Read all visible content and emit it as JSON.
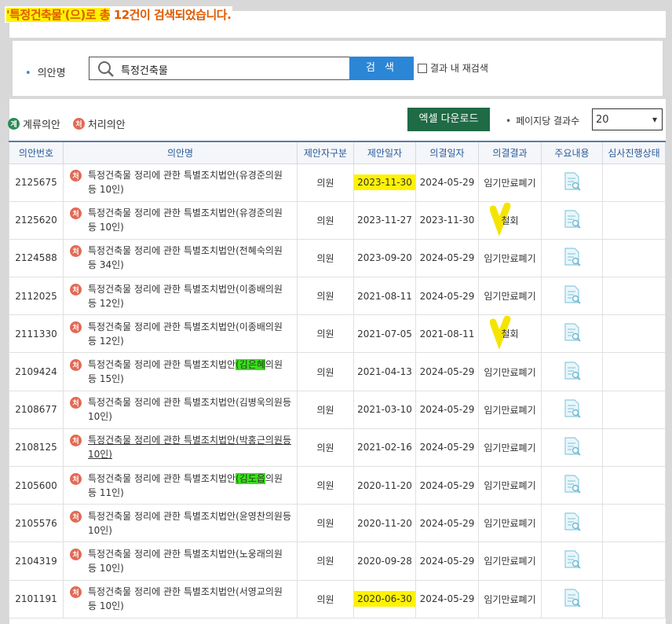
{
  "result_message": {
    "prefix_highlight": "'특정건축물'(으)로 총",
    "count": "12건",
    "suffix": "이 검색되었습니다."
  },
  "search": {
    "label": "의안명",
    "value": "특정건축물",
    "button": "검 색",
    "re_search_label": "결과 내 재검색"
  },
  "legend": {
    "pending_badge": "계",
    "pending_label": "계류의안",
    "processed_badge": "처",
    "processed_label": "처리의안"
  },
  "toolbar": {
    "excel_label": "엑셀 다운로드",
    "per_page_label": "페이지당 결과수",
    "per_page_value": "20"
  },
  "table": {
    "headers": [
      "의안번호",
      "의안명",
      "제안자구분",
      "제안일자",
      "의결일자",
      "의결결과",
      "주요내용",
      "심사진행상태"
    ],
    "rows": [
      {
        "no": "2125675",
        "title_a": "특정건축물 정리에 관한 특별조치법안(유경준의원",
        "title_b": "등 10인)",
        "proposer": "의원",
        "proposed": "2023-11-30",
        "decided": "2024-05-29",
        "result": "임기만료폐기"
      },
      {
        "no": "2125620",
        "title_a": "특정건축물 정리에 관한 특별조치법안(유경준의원",
        "title_b": "등 10인)",
        "proposer": "의원",
        "proposed": "2023-11-27",
        "decided": "2023-11-30",
        "result": "철회"
      },
      {
        "no": "2124588",
        "title_a": "특정건축물 정리에 관한 특별조치법안(전혜숙의원",
        "title_b": "등 34인)",
        "proposer": "의원",
        "proposed": "2023-09-20",
        "decided": "2024-05-29",
        "result": "임기만료폐기"
      },
      {
        "no": "2112025",
        "title_a": "특정건축물 정리에 관한 특별조치법안(이종배의원",
        "title_b": "등 12인)",
        "proposer": "의원",
        "proposed": "2021-08-11",
        "decided": "2024-05-29",
        "result": "임기만료폐기"
      },
      {
        "no": "2111330",
        "title_a": "특정건축물 정리에 관한 특별조치법안(이종배의원",
        "title_b": "등 12인)",
        "proposer": "의원",
        "proposed": "2021-07-05",
        "decided": "2021-08-11",
        "result": "철회"
      },
      {
        "no": "2109424",
        "title_a": "특정건축물 정리에 관한 특별조치법안(김은혜의원",
        "title_b": "등 15인)",
        "proposer": "의원",
        "proposed": "2021-04-13",
        "decided": "2024-05-29",
        "result": "임기만료폐기"
      },
      {
        "no": "2108677",
        "title_a": "특정건축물 정리에 관한 특별조치법안(김병욱의원등",
        "title_b": "10인)",
        "proposer": "의원",
        "proposed": "2021-03-10",
        "decided": "2024-05-29",
        "result": "임기만료폐기"
      },
      {
        "no": "2108125",
        "title_a": "특정건축물 정리에 관한 특별조치법안(박홍근의원등",
        "title_b": "10인)",
        "proposer": "의원",
        "proposed": "2021-02-16",
        "decided": "2024-05-29",
        "result": "임기만료폐기"
      },
      {
        "no": "2105600",
        "title_a": "특정건축물 정리에 관한 특별조치법안(김도읍의원",
        "title_b": "등 11인)",
        "proposer": "의원",
        "proposed": "2020-11-20",
        "decided": "2024-05-29",
        "result": "임기만료폐기"
      },
      {
        "no": "2105576",
        "title_a": "특정건축물 정리에 관한 특별조치법안(윤영찬의원등",
        "title_b": "10인)",
        "proposer": "의원",
        "proposed": "2020-11-20",
        "decided": "2024-05-29",
        "result": "임기만료폐기"
      },
      {
        "no": "2104319",
        "title_a": "특정건축물 정리에 관한 특별조치법안(노웅래의원",
        "title_b": "등 10인)",
        "proposer": "의원",
        "proposed": "2020-09-28",
        "decided": "2024-05-29",
        "result": "임기만료폐기"
      },
      {
        "no": "2101191",
        "title_a": "특정건축물 정리에 관한 특별조치법안(서영교의원",
        "title_b": "등 10인)",
        "proposer": "의원",
        "proposed": "2020-06-30",
        "decided": "2024-05-29",
        "result": "임기만료폐기"
      }
    ]
  },
  "colors": {
    "highlight_yellow": "#fff200",
    "highlight_green": "#39e01a",
    "search_button": "#2b86d6",
    "excel_button": "#1e6b45",
    "processed_badge": "#e26a55",
    "pending_badge": "#2e8b57"
  }
}
